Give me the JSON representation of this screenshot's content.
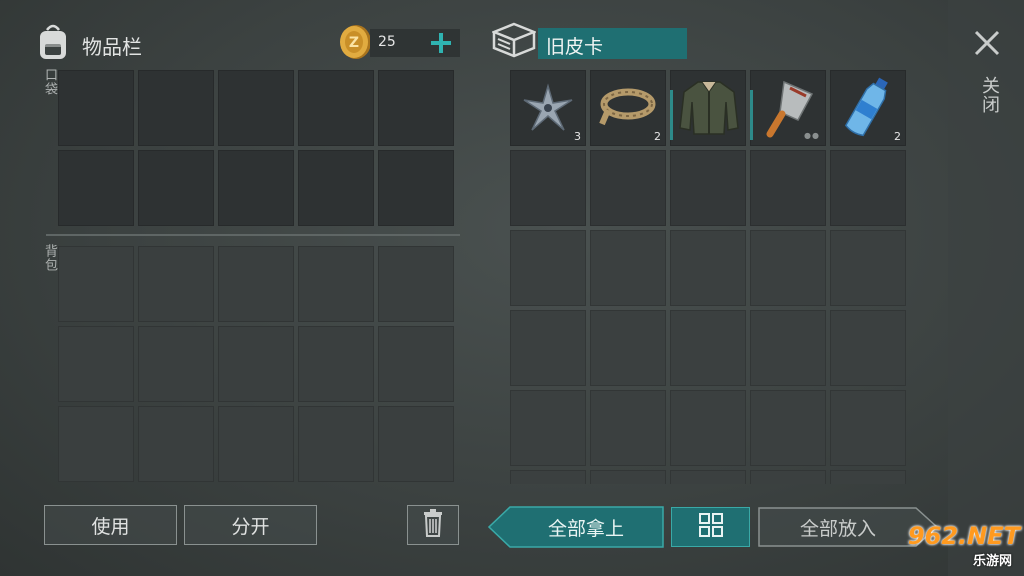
{
  "inventory": {
    "title": "物品栏",
    "coins": "25",
    "pocket_label": "口袋",
    "backpack_label": "背包"
  },
  "crate": {
    "title": "旧皮卡",
    "items": [
      {
        "name": "ninja-star-icon",
        "count": "3"
      },
      {
        "name": "rope-icon",
        "count": "2"
      },
      {
        "name": "jacket-icon",
        "count": ""
      },
      {
        "name": "cleaver-icon",
        "count": ""
      },
      {
        "name": "water-bottle-icon",
        "count": "2"
      }
    ]
  },
  "close_label": "关闭",
  "buttons": {
    "use": "使用",
    "split": "分开",
    "take_all": "全部拿上",
    "put_all": "全部放入"
  },
  "watermark": {
    "brand": "962.NET",
    "sub": "乐游网"
  },
  "colors": {
    "accent_teal": "#1f6f72",
    "coin_gold": "#d8a23a"
  }
}
